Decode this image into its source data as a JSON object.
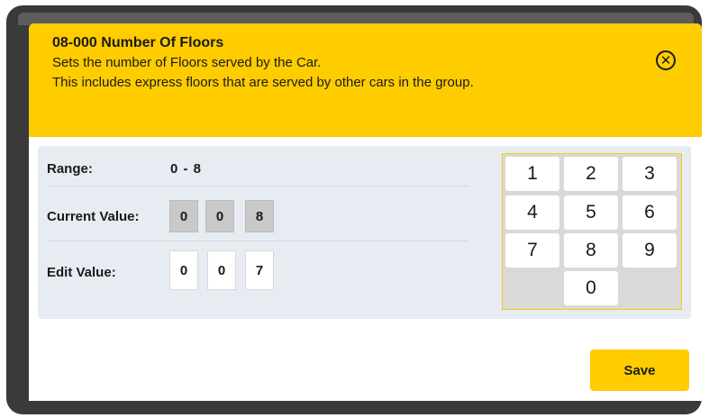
{
  "header": {
    "title": "08-000 Number Of Floors",
    "description_line1": "Sets the number of Floors served by the Car.",
    "description_line2": "This includes express floors that are served by other cars in the group.",
    "close_icon": "close-circle-icon"
  },
  "range": {
    "label": "Range:",
    "value": "0 - 8"
  },
  "current_value": {
    "label": "Current Value:",
    "digits": [
      "0",
      "0",
      "8"
    ]
  },
  "edit_value": {
    "label": "Edit Value:",
    "digits": [
      "0",
      "0",
      "7"
    ]
  },
  "keypad": {
    "keys": [
      "1",
      "2",
      "3",
      "4",
      "5",
      "6",
      "7",
      "8",
      "9",
      "0"
    ]
  },
  "actions": {
    "save_label": "Save"
  },
  "colors": {
    "accent": "#ffcc00",
    "panel": "#e7ebf2",
    "current_digit_bg": "#c9c9c9"
  }
}
